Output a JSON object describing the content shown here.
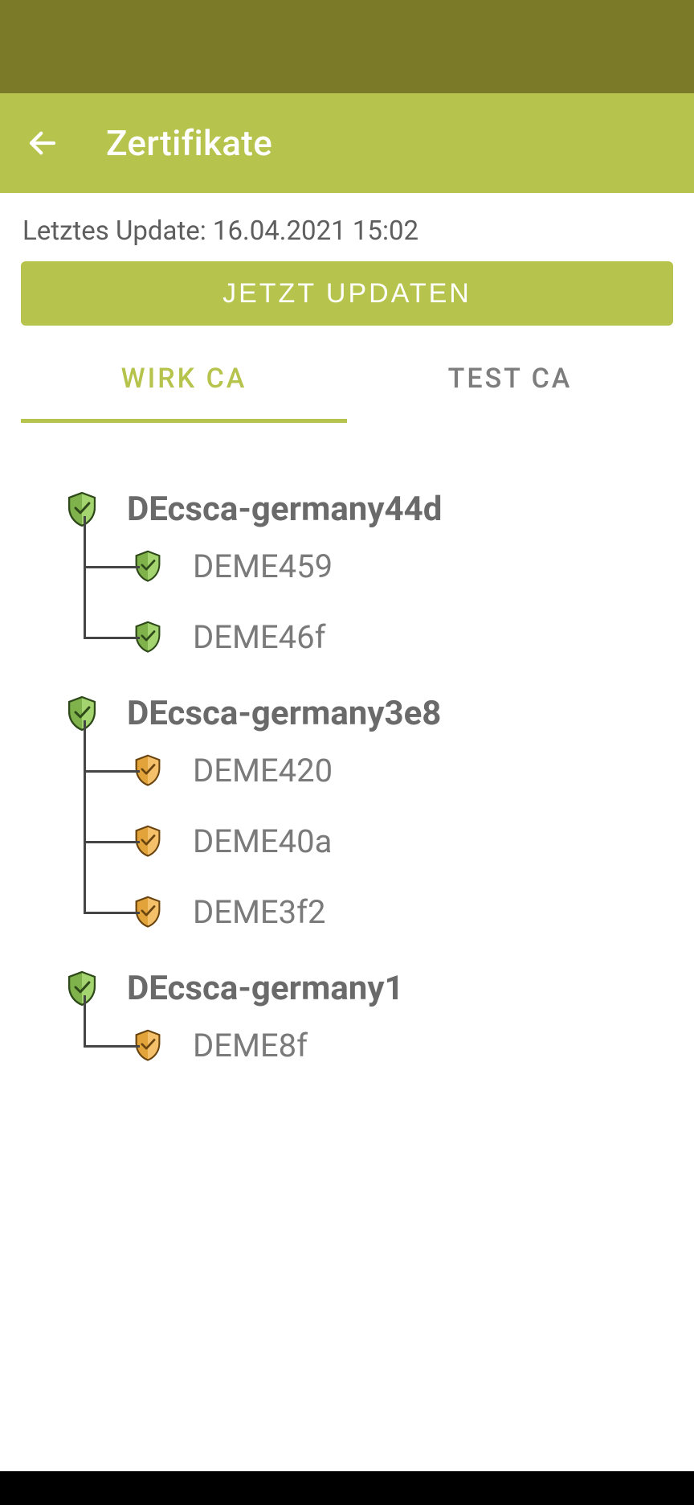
{
  "header": {
    "title": "Zertifikate"
  },
  "update": {
    "last_update_label": "Letztes Update: 16.04.2021 15:02",
    "button_label": "JETZT UPDATEN"
  },
  "tabs": [
    {
      "label": "WIRK CA",
      "active": true
    },
    {
      "label": "TEST CA",
      "active": false
    }
  ],
  "groups": [
    {
      "name": "DEcsca-germany44d",
      "shield": "green",
      "children": [
        {
          "name": "DEME459",
          "shield": "green"
        },
        {
          "name": "DEME46f",
          "shield": "green"
        }
      ]
    },
    {
      "name": "DEcsca-germany3e8",
      "shield": "green",
      "children": [
        {
          "name": "DEME420",
          "shield": "orange"
        },
        {
          "name": "DEME40a",
          "shield": "orange"
        },
        {
          "name": "DEME3f2",
          "shield": "orange"
        }
      ]
    },
    {
      "name": "DEcsca-germany1",
      "shield": "green",
      "children": [
        {
          "name": "DEME8f",
          "shield": "orange"
        }
      ]
    }
  ]
}
